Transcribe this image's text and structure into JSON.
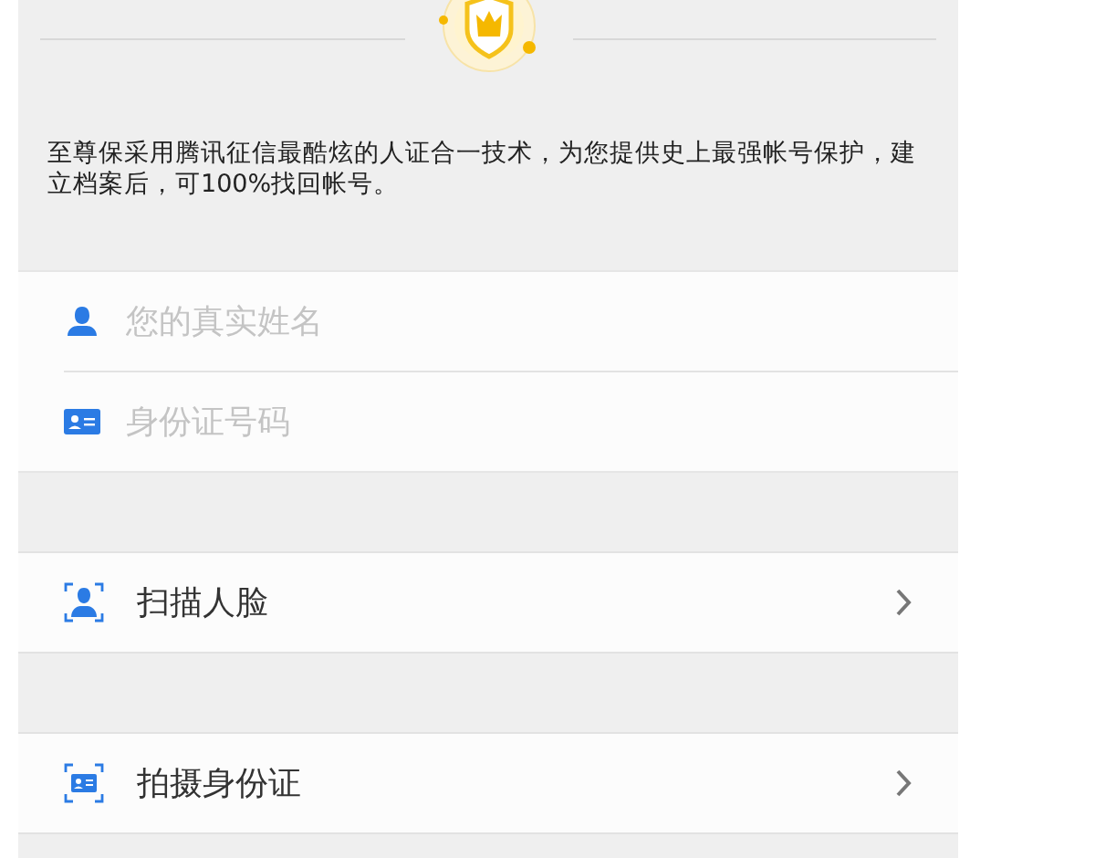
{
  "intro": "至尊保采用腾讯征信最酷炫的人证合一技术，为您提供史上最强帐号保护，建立档案后，可100%找回帐号。",
  "fields": [
    {
      "kind": "person",
      "placeholder": "您的真实姓名"
    },
    {
      "kind": "id-card",
      "placeholder": "身份证号码"
    }
  ],
  "actions": [
    {
      "kind": "face",
      "label": "扫描人脸"
    },
    {
      "kind": "id-card",
      "label": "拍摄身份证"
    }
  ]
}
